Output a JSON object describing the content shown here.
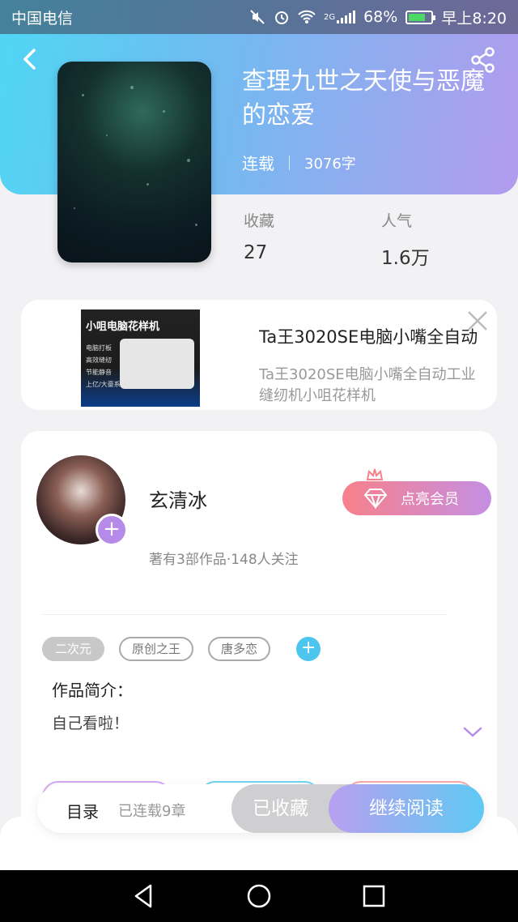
{
  "status_bar": {
    "carrier": "中国电信",
    "network": "2G",
    "battery": "68%",
    "time": "早上8:20"
  },
  "book": {
    "title": "查理九世之天使与恶魔的恋爱",
    "status": "连载",
    "word_count": "3076字",
    "stats": [
      {
        "label": "收藏",
        "value": "27"
      },
      {
        "label": "人气",
        "value": "1.6万"
      }
    ]
  },
  "ad": {
    "image_text": "小咀电脑花样机",
    "image_list": [
      "电脑打板",
      "高效缝纫",
      "节能静音",
      "上亿/大豪系统"
    ],
    "title": "Ta王3020SE电脑小嘴全自动",
    "description_line1": "Ta王3020SE电脑小嘴全自动工业",
    "description_line2": "缝纫机小咀花样机"
  },
  "author": {
    "name": "玄清冰",
    "works": "著有3部作品·148人关注",
    "vip_label": "点亮会员"
  },
  "tags": [
    "二次元",
    "原创之王",
    "唐多恋"
  ],
  "intro": {
    "label": "作品简介：",
    "text": "自己看啦！"
  },
  "bottom": {
    "catalog_label": "目录",
    "chapters": "已连载9章",
    "collected_label": "已收藏",
    "continue_label": "继续阅读"
  },
  "colors": {
    "header_gradient_start": "#4fd6f4",
    "header_gradient_end": "#b39bee",
    "vip_gradient_start": "#f7808a",
    "vip_gradient_end": "#c58fe3",
    "tag_add": "#4cc6ee"
  }
}
